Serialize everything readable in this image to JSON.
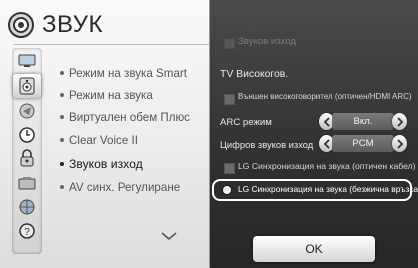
{
  "header": {
    "title": "ЗВУК",
    "icon": "sound-icon"
  },
  "sidebar_icons": [
    {
      "name": "picture-icon"
    },
    {
      "name": "sound-icon",
      "selected": true
    },
    {
      "name": "channel-icon"
    },
    {
      "name": "clock-icon"
    },
    {
      "name": "lock-icon"
    },
    {
      "name": "option-icon"
    },
    {
      "name": "network-icon"
    },
    {
      "name": "support-icon"
    }
  ],
  "menu": {
    "items": [
      {
        "label": "Режим на звука Smart"
      },
      {
        "label": "Режим на звука"
      },
      {
        "label": "Виртуален обем Плюс"
      },
      {
        "label": "Clear Voice II"
      },
      {
        "label": "Звуков изход",
        "active": true
      },
      {
        "label": "AV синх. Регулиране"
      }
    ]
  },
  "panel": {
    "sound_out_label": "Звуков изход",
    "tv_speaker_label": "TV Високогов.",
    "external_speaker_label": "Външен високоговорител (оптичен/HDMI ARC)",
    "arc_mode_label": "ARC режим",
    "arc_mode_value": "Вкл.",
    "digital_out_label": "Цифров звуков изход",
    "digital_out_value": "PCM",
    "lg_sync_optical_label": "LG Синхронизация на звука (оптичен кабел)",
    "lg_sync_wireless_label": "LG Синхронизация на звука (безжична връзка)",
    "ok_label": "OK"
  }
}
